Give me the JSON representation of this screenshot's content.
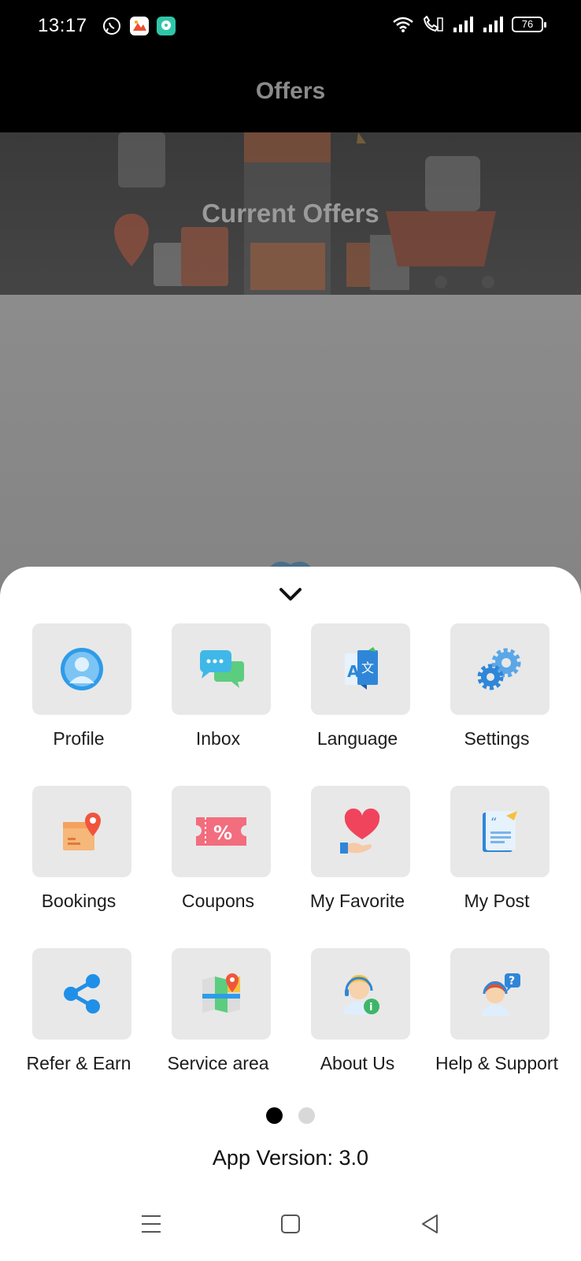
{
  "status_bar": {
    "time": "13:17",
    "battery": "76"
  },
  "app_bar": {
    "title": "Offers"
  },
  "banner": {
    "title": "Current Offers"
  },
  "menu": {
    "items": [
      {
        "label": "Profile",
        "icon": "profile-icon"
      },
      {
        "label": "Inbox",
        "icon": "inbox-icon"
      },
      {
        "label": "Language",
        "icon": "language-icon"
      },
      {
        "label": "Settings",
        "icon": "settings-icon"
      },
      {
        "label": "Bookings",
        "icon": "bookings-icon"
      },
      {
        "label": "Coupons",
        "icon": "coupons-icon"
      },
      {
        "label": "My Favorite",
        "icon": "favorite-icon"
      },
      {
        "label": "My Post",
        "icon": "post-icon"
      },
      {
        "label": "Refer & Earn",
        "icon": "share-icon"
      },
      {
        "label": "Service area",
        "icon": "map-icon"
      },
      {
        "label": "About Us",
        "icon": "about-icon"
      },
      {
        "label": "Help & Support",
        "icon": "support-icon"
      }
    ]
  },
  "pager": {
    "current_page": 1,
    "total_pages": 2
  },
  "footer": {
    "version": "App Version: 3.0"
  },
  "colors": {
    "accent_blue": "#2f9be8",
    "sheet_bg": "#ffffff",
    "tile_bg": "#e8e8e8"
  }
}
